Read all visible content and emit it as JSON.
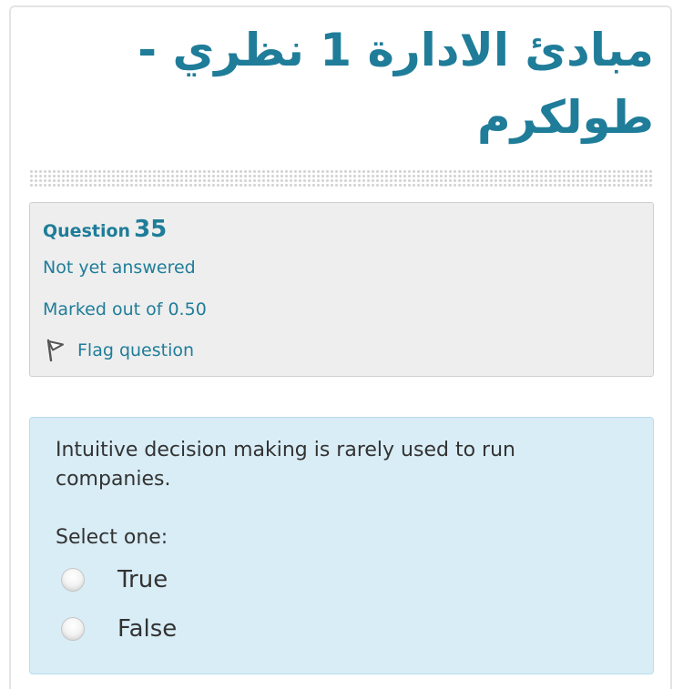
{
  "course": {
    "title": "مبادئ الادارة 1 نظري - طولكرم"
  },
  "question_info": {
    "label": "Question",
    "number": "35",
    "state": "Not yet answered",
    "grade": "Marked out of 0.50",
    "flag_label": "Flag question",
    "flag_icon": "flag-icon"
  },
  "question": {
    "text": "Intuitive decision making is rarely used to run companies.",
    "prompt": "Select one:",
    "options": [
      {
        "label": "True",
        "selected": false
      },
      {
        "label": "False",
        "selected": false
      }
    ]
  },
  "colors": {
    "accent": "#1f7d99",
    "info_background": "#eeeeee",
    "question_background": "#d9edf6",
    "question_border": "#b9dcec",
    "text": "#333333"
  }
}
